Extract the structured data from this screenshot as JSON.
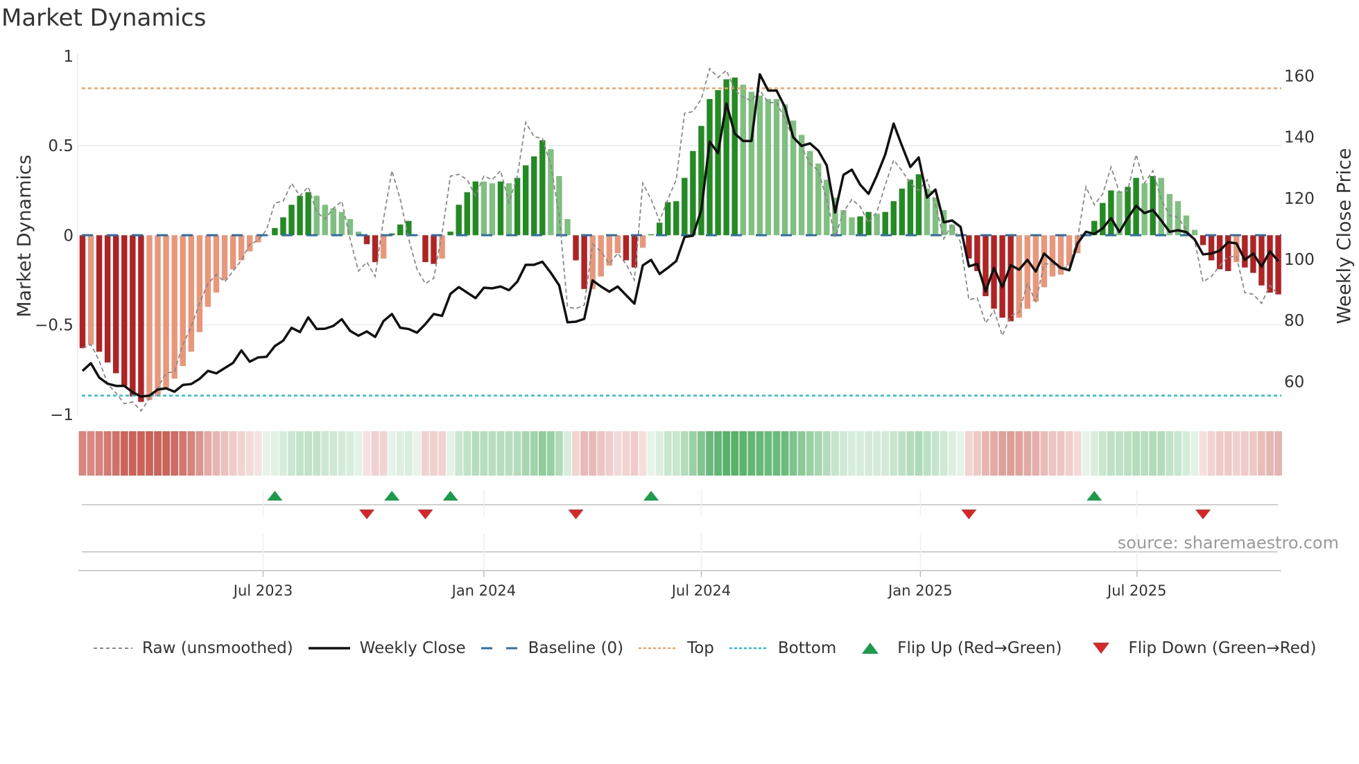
{
  "chart_data": {
    "type": "bar",
    "title": "Market Dynamics",
    "ylabel": "Market Dynamics",
    "y2label": "Weekly Close Price",
    "ylim": [
      -1,
      1
    ],
    "y2lim": [
      50,
      170
    ],
    "yticks": [
      {
        "v": 1,
        "label": "1"
      },
      {
        "v": 0.5,
        "label": "0.5"
      },
      {
        "v": 0,
        "label": "0"
      },
      {
        "v": -0.5,
        "label": "−0.5"
      },
      {
        "v": -1,
        "label": "−1"
      }
    ],
    "y2ticks": [
      {
        "v": 60,
        "label": "60"
      },
      {
        "v": 80,
        "label": "80"
      },
      {
        "v": 100,
        "label": "100"
      },
      {
        "v": 120,
        "label": "120"
      },
      {
        "v": 140,
        "label": "140"
      },
      {
        "v": 160,
        "label": "160"
      }
    ],
    "x_unit": "week index (1-based)",
    "xticks": [
      {
        "pos": 22.6,
        "label": "Jul 2023"
      },
      {
        "pos": 49.0,
        "label": "Jan 2024"
      },
      {
        "pos": 75.0,
        "label": "Jul 2024"
      },
      {
        "pos": 101.2,
        "label": "Jan 2025"
      },
      {
        "pos": 127.1,
        "label": "Jul 2025"
      }
    ],
    "top_level": 0.82,
    "bottom_level": -0.895,
    "baseline": 0,
    "series": [
      {
        "name": "Market Dynamics (smoothed)",
        "type": "bar",
        "values": [
          -0.63,
          -0.61,
          -0.65,
          -0.71,
          -0.77,
          -0.84,
          -0.9,
          -0.93,
          -0.92,
          -0.9,
          -0.85,
          -0.8,
          -0.73,
          -0.65,
          -0.54,
          -0.4,
          -0.32,
          -0.25,
          -0.19,
          -0.14,
          -0.09,
          -0.04,
          0.0,
          0.04,
          0.1,
          0.17,
          0.22,
          0.24,
          0.22,
          0.17,
          0.15,
          0.13,
          0.09,
          0.02,
          -0.05,
          -0.15,
          -0.13,
          0.01,
          0.06,
          0.08,
          0.0,
          -0.15,
          -0.16,
          -0.13,
          0.02,
          0.17,
          0.24,
          0.3,
          0.3,
          0.29,
          0.3,
          0.29,
          0.32,
          0.39,
          0.44,
          0.53,
          0.48,
          0.33,
          0.09,
          -0.14,
          -0.3,
          -0.3,
          -0.23,
          -0.17,
          -0.1,
          -0.14,
          -0.18,
          -0.07,
          0.005,
          0.07,
          0.185,
          0.19,
          0.32,
          0.47,
          0.61,
          0.76,
          0.81,
          0.87,
          0.88,
          0.84,
          0.8,
          0.78,
          0.76,
          0.76,
          0.73,
          0.64,
          0.56,
          0.47,
          0.4,
          0.31,
          0.21,
          0.14,
          0.1,
          0.105,
          0.13,
          0.12,
          0.13,
          0.19,
          0.26,
          0.31,
          0.34,
          0.26,
          0.21,
          0.14,
          0.06,
          0.0,
          -0.13,
          -0.2,
          -0.34,
          -0.41,
          -0.46,
          -0.48,
          -0.46,
          -0.41,
          -0.37,
          -0.29,
          -0.23,
          -0.22,
          -0.17,
          -0.1,
          0.0,
          0.08,
          0.18,
          0.25,
          0.245,
          0.27,
          0.32,
          0.29,
          0.33,
          0.32,
          0.23,
          0.19,
          0.11,
          0.03,
          -0.055,
          -0.14,
          -0.19,
          -0.2,
          -0.15,
          -0.18,
          -0.21,
          -0.28,
          -0.32,
          -0.33
        ]
      },
      {
        "name": "Raw (unsmoothed)",
        "type": "line",
        "values": [
          -0.63,
          -0.61,
          -0.7,
          -0.83,
          -0.88,
          -0.94,
          -0.93,
          -0.98,
          -0.91,
          -0.85,
          -0.77,
          -0.76,
          -0.61,
          -0.51,
          -0.38,
          -0.27,
          -0.22,
          -0.26,
          -0.2,
          -0.14,
          -0.05,
          -0.03,
          0.03,
          0.18,
          0.19,
          0.29,
          0.22,
          0.27,
          0.13,
          0.09,
          0.15,
          0.19,
          -0.02,
          -0.2,
          -0.15,
          -0.23,
          0.09,
          0.36,
          0.2,
          -0.02,
          -0.19,
          -0.27,
          -0.24,
          0.01,
          0.33,
          0.34,
          0.31,
          0.22,
          0.33,
          0.31,
          0.36,
          0.18,
          0.33,
          0.63,
          0.55,
          0.54,
          0.39,
          0.11,
          -0.4,
          -0.41,
          -0.39,
          -0.05,
          -0.09,
          -0.16,
          -0.1,
          -0.16,
          -0.25,
          0.29,
          0.2,
          0.08,
          0.2,
          0.31,
          0.68,
          0.69,
          0.76,
          0.93,
          0.88,
          0.92,
          0.81,
          0.77,
          0.75,
          0.81,
          0.74,
          0.74,
          0.65,
          0.54,
          0.49,
          0.4,
          0.36,
          0.2,
          -0.01,
          0.13,
          0.2,
          0.16,
          0.07,
          0.13,
          0.28,
          0.42,
          0.36,
          0.29,
          0.25,
          0.31,
          0.17,
          -0.02,
          0.06,
          -0.04,
          -0.36,
          -0.35,
          -0.49,
          -0.42,
          -0.56,
          -0.45,
          -0.43,
          -0.27,
          -0.37,
          -0.16,
          -0.16,
          -0.19,
          -0.17,
          -0.02,
          0.27,
          0.17,
          0.23,
          0.38,
          0.24,
          0.25,
          0.45,
          0.29,
          0.36,
          0.2,
          0.11,
          0.1,
          0.03,
          -0.03,
          -0.26,
          -0.23,
          -0.17,
          -0.12,
          -0.12,
          -0.32,
          -0.33,
          -0.38,
          -0.28,
          -0.33
        ]
      },
      {
        "name": "Weekly Close",
        "type": "line",
        "axis": "right",
        "values": [
          63.5,
          66,
          61.3,
          59.3,
          58.6,
          58.6,
          56.5,
          55.1,
          55.4,
          57.4,
          57.8,
          56.7,
          58.9,
          59.2,
          60.9,
          63.5,
          62.7,
          64.4,
          66.1,
          70.2,
          66.5,
          67.9,
          68.1,
          71.6,
          73.4,
          77.6,
          76.2,
          81.0,
          77.2,
          77.3,
          78.2,
          80.4,
          76.6,
          75.0,
          76.4,
          74.6,
          79.8,
          82.1,
          77.6,
          77.2,
          76.0,
          78.8,
          82.1,
          81.5,
          88.7,
          90.9,
          89.1,
          87.3,
          90.7,
          90.5,
          91.1,
          89.9,
          92.7,
          98.2,
          98.2,
          99.2,
          95.6,
          91.5,
          79.4,
          79.6,
          80.5,
          93.1,
          91.1,
          89.4,
          91.1,
          88.3,
          85.5,
          98.0,
          99.8,
          95.2,
          97.2,
          99.4,
          107.3,
          107.7,
          116.1,
          138.5,
          134.7,
          151.0,
          141.1,
          138.7,
          138.7,
          160.5,
          155.2,
          155.2,
          149.8,
          139.9,
          137.1,
          137.9,
          135.5,
          130.7,
          115.3,
          127.6,
          129.3,
          124.4,
          121.4,
          127.4,
          134.3,
          144.4,
          137.1,
          130.2,
          133.3,
          120.2,
          122.8,
          112.1,
          112.7,
          110.6,
          97.7,
          98.5,
          89.5,
          97.2,
          90.9,
          98.1,
          96.6,
          99.8,
          96.0,
          101.9,
          99.4,
          97.2,
          96.4,
          105.2,
          109.0,
          108.3,
          110.1,
          113.5,
          108.9,
          113.5,
          117.5,
          115.1,
          116.1,
          112.7,
          109.0,
          109.5,
          108.9,
          106.5,
          101.6,
          101.9,
          102.8,
          105.6,
          105.2,
          99.8,
          101.9,
          97.6,
          102.6,
          99.4
        ]
      }
    ],
    "flips_up": [
      24,
      38,
      45,
      69,
      122
    ],
    "flips_down": [
      35,
      42,
      60,
      107,
      135
    ],
    "legend": {
      "placement": "bottom",
      "items": [
        "Raw (unsmoothed)",
        "Weekly Close",
        "Baseline (0)",
        "Top",
        "Bottom",
        "Flip Up (Red→Green)",
        "Flip Down (Green→Red)"
      ]
    },
    "source": "source: sharemaestro.com",
    "colors": {
      "bar_pos_strong": "#228b22",
      "bar_pos_weak": "#7fbf7f",
      "bar_neg_strong": "#b22222",
      "bar_neg_weak": "#e9967a",
      "baseline": "#2e6fa7",
      "top": "#f4a261",
      "bottom": "#22c3d6",
      "raw": "#888888",
      "close": "#111111",
      "flip_up": "#1a9c4a",
      "flip_down": "#d62728"
    }
  }
}
